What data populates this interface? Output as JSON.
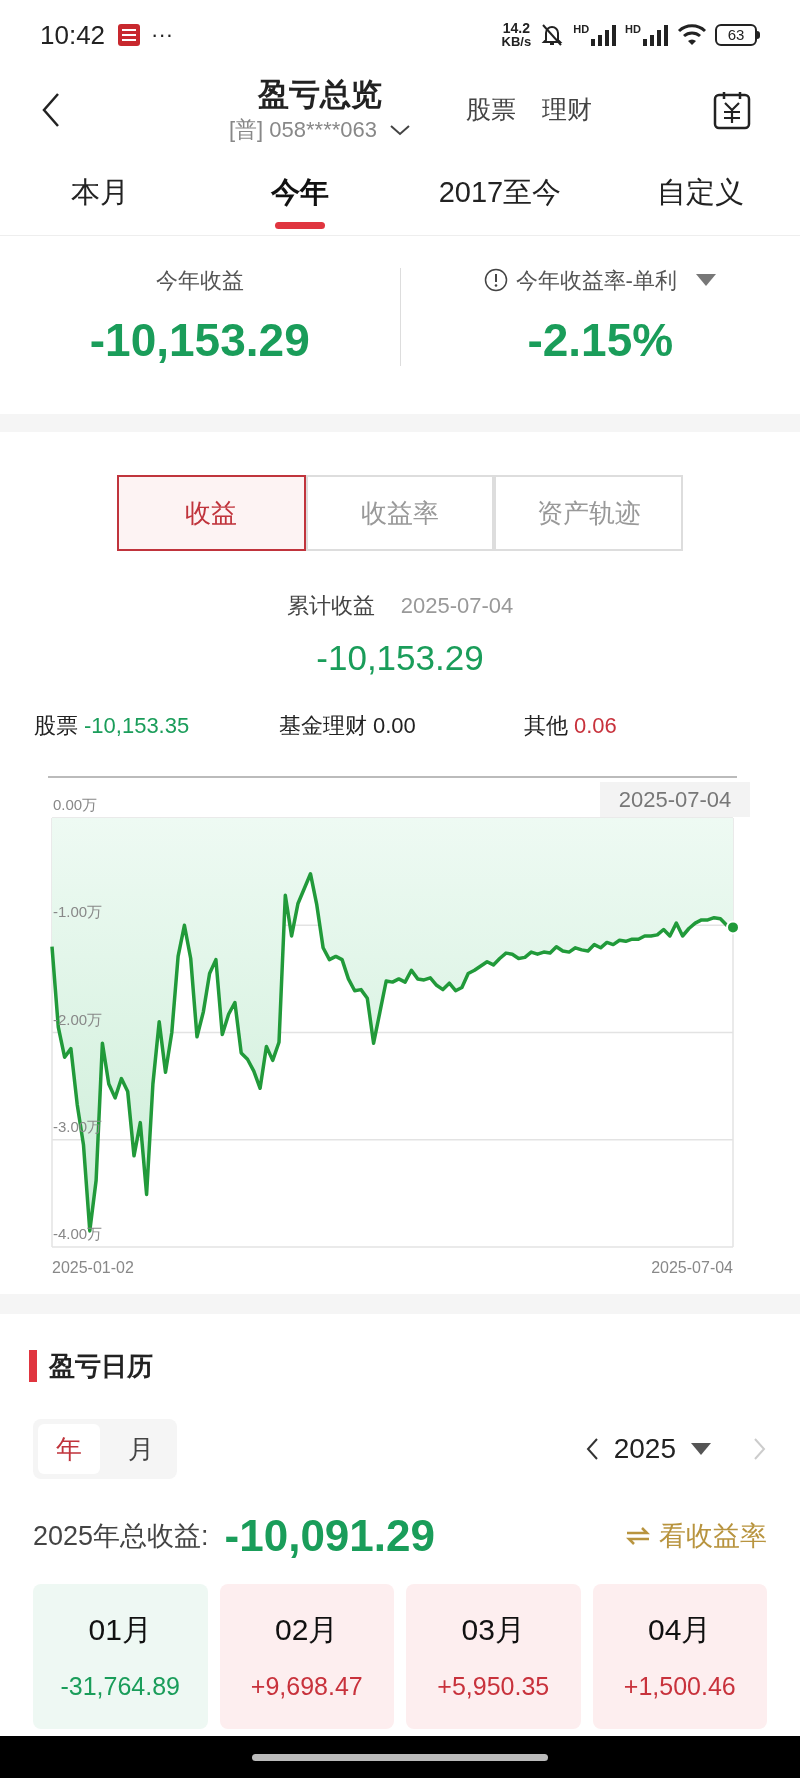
{
  "status_bar": {
    "time": "10:42",
    "more": "···",
    "net_speed_value": "14.2",
    "net_speed_unit": "KB/s",
    "signal_labels": [
      "HD",
      "HD"
    ],
    "battery": "63"
  },
  "header": {
    "title": "盈亏总览",
    "account": "[普] 058****063",
    "links": [
      "股票",
      "理财"
    ]
  },
  "period_tabs": [
    {
      "label": "本月",
      "selected": false
    },
    {
      "label": "今年",
      "selected": true
    },
    {
      "label": "2017至今",
      "selected": false
    },
    {
      "label": "自定义",
      "selected": false
    }
  ],
  "summary": [
    {
      "label": "今年收益",
      "value": "-10,153.29",
      "kind": "amount"
    },
    {
      "label": "今年收益率-单利",
      "value": "-2.15%",
      "kind": "rate"
    }
  ],
  "chart_tabs": [
    {
      "label": "收益",
      "selected": true
    },
    {
      "label": "收益率",
      "selected": false
    },
    {
      "label": "资产轨迹",
      "selected": false
    }
  ],
  "cumulative": {
    "label": "累计收益",
    "date": "2025-07-04",
    "value": "-10,153.29",
    "breakdown": [
      {
        "label": "股票",
        "value": "-10,153.35",
        "color": "#1a9d5a"
      },
      {
        "label": "基金理财",
        "value": "0.00",
        "color": "#222222"
      },
      {
        "label": "其他",
        "value": "0.06",
        "color": "#c8323c"
      }
    ],
    "tooltip_date": "2025-07-04",
    "axis_start_date": "2025-01-02",
    "axis_end_date": "2025-07-04",
    "chart_data": {
      "type": "area",
      "grid": true,
      "ylim": [
        -4,
        0
      ],
      "yticks": [
        {
          "value": 0,
          "label": "0.00万"
        },
        {
          "value": -1,
          "label": "-1.00万"
        },
        {
          "value": -2,
          "label": "-2.00万"
        },
        {
          "value": -3,
          "label": "-3.00万"
        },
        {
          "value": -4,
          "label": "-4.00万"
        }
      ],
      "series": [
        {
          "color": "#219a3a",
          "values": [
            -1.2,
            -1.95,
            -2.23,
            -2.15,
            -2.67,
            -3.05,
            -3.85,
            -3.38,
            -2.1,
            -2.48,
            -2.61,
            -2.43,
            -2.55,
            -3.15,
            -2.84,
            -3.51,
            -2.48,
            -1.9,
            -2.37,
            -2.0,
            -1.29,
            -1.0,
            -1.31,
            -2.04,
            -1.81,
            -1.45,
            -1.32,
            -2.02,
            -1.83,
            -1.72,
            -2.19,
            -2.25,
            -2.36,
            -2.52,
            -2.13,
            -2.26,
            -2.09,
            -0.72,
            -1.1,
            -0.8,
            -0.66,
            -0.52,
            -0.81,
            -1.21,
            -1.32,
            -1.29,
            -1.32,
            -1.5,
            -1.61,
            -1.6,
            -1.68,
            -2.1,
            -1.81,
            -1.52,
            -1.53,
            -1.5,
            -1.53,
            -1.42,
            -1.5,
            -1.51,
            -1.49,
            -1.56,
            -1.6,
            -1.54,
            -1.61,
            -1.58,
            -1.45,
            -1.42,
            -1.38,
            -1.34,
            -1.37,
            -1.31,
            -1.26,
            -1.27,
            -1.31,
            -1.3,
            -1.25,
            -1.27,
            -1.25,
            -1.26,
            -1.2,
            -1.24,
            -1.25,
            -1.21,
            -1.23,
            -1.24,
            -1.18,
            -1.21,
            -1.16,
            -1.18,
            -1.14,
            -1.15,
            -1.13,
            -1.13,
            -1.1,
            -1.1,
            -1.09,
            -1.04,
            -1.1,
            -0.98,
            -1.1,
            -1.03,
            -0.98,
            -0.95,
            -0.95,
            -0.93,
            -0.94,
            -1.0,
            -1.02
          ]
        }
      ]
    }
  },
  "calendar": {
    "title": "盈亏日历",
    "modes": [
      {
        "label": "年",
        "selected": true
      },
      {
        "label": "月",
        "selected": false
      }
    ],
    "year": "2025",
    "prev_disabled": false,
    "next_disabled": true,
    "total_label": "2025年总收益:",
    "total_value": "-10,091.29",
    "rate_link": "看收益率",
    "months": [
      {
        "label": "01月",
        "value": "-31,764.89",
        "kind": "loss"
      },
      {
        "label": "02月",
        "value": "+9,698.47",
        "kind": "gain"
      },
      {
        "label": "03月",
        "value": "+5,950.35",
        "kind": "gain"
      },
      {
        "label": "04月",
        "value": "+1,500.46",
        "kind": "gain"
      }
    ]
  }
}
